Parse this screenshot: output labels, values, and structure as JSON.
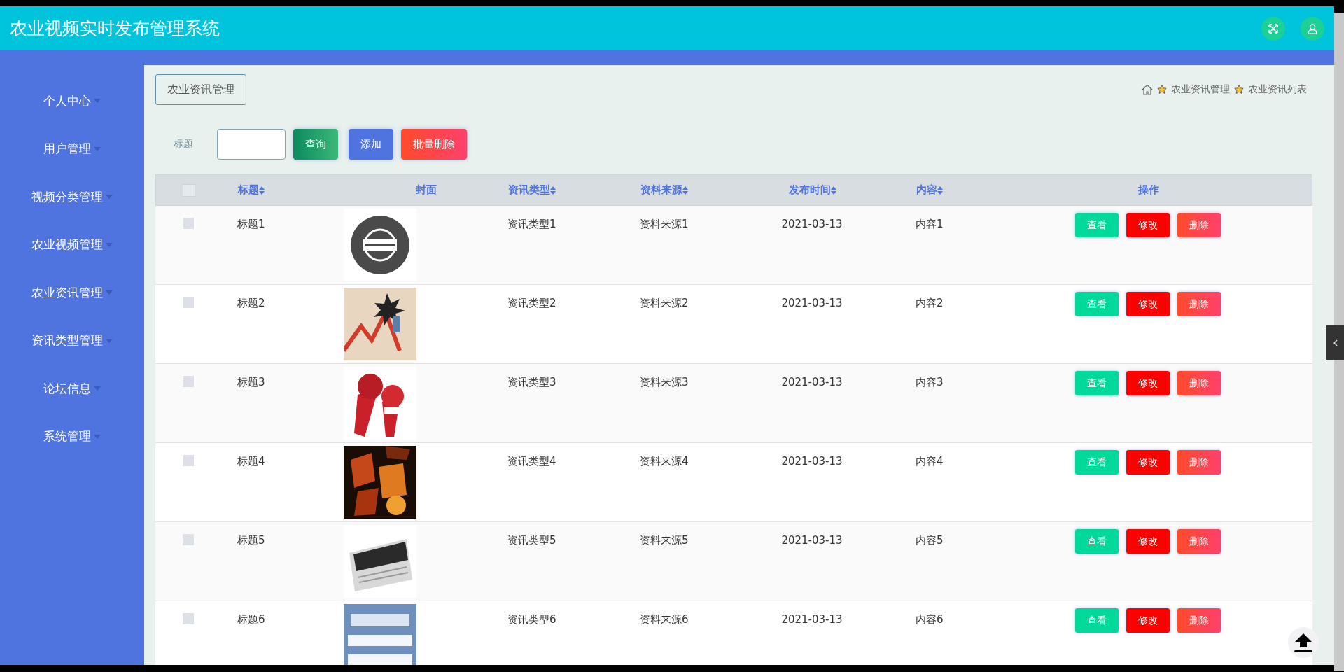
{
  "header": {
    "title": "农业视频实时发布管理系统"
  },
  "sidebar": {
    "items": [
      {
        "label": "个人中心"
      },
      {
        "label": "用户管理"
      },
      {
        "label": "视频分类管理"
      },
      {
        "label": "农业视频管理"
      },
      {
        "label": "农业资讯管理"
      },
      {
        "label": "资讯类型管理"
      },
      {
        "label": "论坛信息"
      },
      {
        "label": "系统管理"
      }
    ]
  },
  "page_title": "农业资讯管理",
  "breadcrumb": [
    "农业资讯管理",
    "农业资讯列表"
  ],
  "search": {
    "label": "标题",
    "buttons": [
      {
        "label": "查询",
        "kind": "search"
      },
      {
        "label": "添加",
        "kind": "add"
      },
      {
        "label": "批量删除",
        "kind": "delete"
      }
    ]
  },
  "table": {
    "select_all_checked": false,
    "columns": [
      {
        "label": "标题",
        "sortable": true
      },
      {
        "label": "封面",
        "sortable": false
      },
      {
        "label": "资讯类型",
        "sortable": true
      },
      {
        "label": "资料来源",
        "sortable": true
      },
      {
        "label": "发布时间",
        "sortable": true
      },
      {
        "label": "内容",
        "sortable": true
      },
      {
        "label": "操作",
        "sortable": false
      }
    ],
    "rows": [
      {
        "checked": false,
        "title": "标题1",
        "type": "资讯类型1",
        "source": "资料来源1",
        "date": "2021-03-13",
        "content": "内容1",
        "actions": [
          {
            "label": "查看",
            "kind": "view"
          },
          {
            "label": "修改",
            "kind": "edit"
          },
          {
            "label": "删除",
            "kind": "delete"
          }
        ]
      },
      {
        "checked": false,
        "title": "标题2",
        "type": "资讯类型2",
        "source": "资料来源2",
        "date": "2021-03-13",
        "content": "内容2",
        "actions": [
          {
            "label": "查看",
            "kind": "view"
          },
          {
            "label": "修改",
            "kind": "edit"
          },
          {
            "label": "删除",
            "kind": "delete"
          }
        ]
      },
      {
        "checked": false,
        "title": "标题3",
        "type": "资讯类型3",
        "source": "资料来源3",
        "date": "2021-03-13",
        "content": "内容3",
        "actions": [
          {
            "label": "查看",
            "kind": "view"
          },
          {
            "label": "修改",
            "kind": "edit"
          },
          {
            "label": "删除",
            "kind": "delete"
          }
        ]
      },
      {
        "checked": false,
        "title": "标题4",
        "type": "资讯类型4",
        "source": "资料来源4",
        "date": "2021-03-13",
        "content": "内容4",
        "actions": [
          {
            "label": "查看",
            "kind": "view"
          },
          {
            "label": "修改",
            "kind": "edit"
          },
          {
            "label": "删除",
            "kind": "delete"
          }
        ]
      },
      {
        "checked": false,
        "title": "标题5",
        "type": "资讯类型5",
        "source": "资料来源5",
        "date": "2021-03-13",
        "content": "内容5",
        "actions": [
          {
            "label": "查看",
            "kind": "view"
          },
          {
            "label": "修改",
            "kind": "edit"
          },
          {
            "label": "删除",
            "kind": "delete"
          }
        ]
      },
      {
        "checked": false,
        "title": "标题6",
        "type": "资讯类型6",
        "source": "资料来源6",
        "date": "2021-03-13",
        "content": "内容6",
        "actions": [
          {
            "label": "查看",
            "kind": "view"
          },
          {
            "label": "修改",
            "kind": "edit"
          },
          {
            "label": "删除",
            "kind": "delete"
          }
        ]
      }
    ]
  }
}
